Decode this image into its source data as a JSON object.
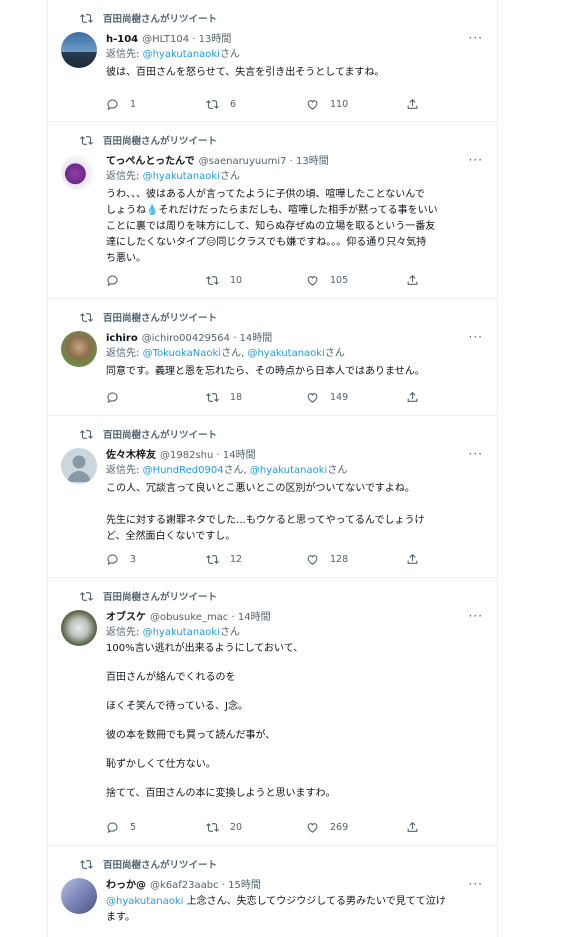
{
  "retweet_label": "百田尚樹さんがリツイート",
  "reply_prefix": "返信先:",
  "more_glyph": "···",
  "tweets": [
    {
      "name": "h-104",
      "handle": "@HLT104 · 13時間",
      "replies": [
        {
          "lnk": "@hyakutanaoki",
          "suffix": "さん"
        }
      ],
      "lines": [
        "彼は、百田さんを怒らせて、失言を引き出そうとしてますね。"
      ],
      "stats": {
        "reply": "1",
        "retweet": "6",
        "like": "110"
      }
    },
    {
      "name": "てっぺんとったんで",
      "handle": "@saenaruyuumi7 · 13時間",
      "replies": [
        {
          "lnk": "@hyakutanaoki",
          "suffix": "さん"
        }
      ],
      "lines": [
        "うわ、、、彼はある人が言ってたように子供の頃、喧嘩したことないんで",
        "しょうね💧それだけだったらまだしも、喧嘩した相手が黙ってる事をいい",
        "ことに裏では周りを味方にして、知らぬ存ぜぬの立場を取るという一番友",
        "達にしたくないタイプ😑同じクラスでも嫌ですね。。。仰る通り只々気持",
        "ち悪い。"
      ],
      "stats": {
        "reply": "",
        "retweet": "10",
        "like": "105"
      }
    },
    {
      "name": "ichiro",
      "handle": "@ichiro00429564 · 14時間",
      "replies": [
        {
          "lnk": "@TokuokaNaoki",
          "suffix": "さん, "
        },
        {
          "lnk": "@hyakutanaoki",
          "suffix": "さん"
        }
      ],
      "lines": [
        "同意です。義理と恩を忘れたら、その時点から日本人ではありません。"
      ],
      "stats": {
        "reply": "",
        "retweet": "18",
        "like": "149"
      }
    },
    {
      "name": "佐々木梓友",
      "handle": "@1982shu · 14時間",
      "replies": [
        {
          "lnk": "@HundRed0904",
          "suffix": "さん, "
        },
        {
          "lnk": "@hyakutanaoki",
          "suffix": "さん"
        }
      ],
      "lines": [
        "この人、冗談言って良いとこ悪いとこの区別がついてないですよね。",
        "",
        "先生に対する謝罪ネタでした…もウケると思ってやってるんでしょうけ",
        "ど、全然面白くないですし。"
      ],
      "stats": {
        "reply": "3",
        "retweet": "12",
        "like": "128"
      }
    },
    {
      "name": "オブスケ",
      "handle": "@obusuke_mac · 14時間",
      "replies": [
        {
          "lnk": "@hyakutanaoki",
          "suffix": "さん"
        }
      ],
      "lines": [
        "100%言い逃れが出来るようにしておいて、",
        "",
        "百田さんが絡んでくれるのを",
        "",
        "ほくそ笑んで待っている、J念。",
        "",
        "彼の本を数冊でも買って読んだ事が、",
        "",
        "恥ずかしくて仕方ない。",
        "",
        "捨てて、百田さんの本に変換しようと思いますわ。"
      ],
      "stats": {
        "reply": "5",
        "retweet": "20",
        "like": "269"
      }
    },
    {
      "name": "わっか@",
      "handle": "@k6af23aabc · 15時間",
      "replies": [],
      "lead_link": "@hyakutanaoki",
      "lines": [
        " 上念さん、失恋してウジウジしてる男みたいで見てて泣け",
        "ます。"
      ],
      "stats": {
        "reply": "",
        "retweet": "",
        "like": ""
      }
    }
  ],
  "colors": {
    "link": "#1d9bf0",
    "muted": "#536471",
    "border": "#eff3f4",
    "text": "#0f1419"
  }
}
